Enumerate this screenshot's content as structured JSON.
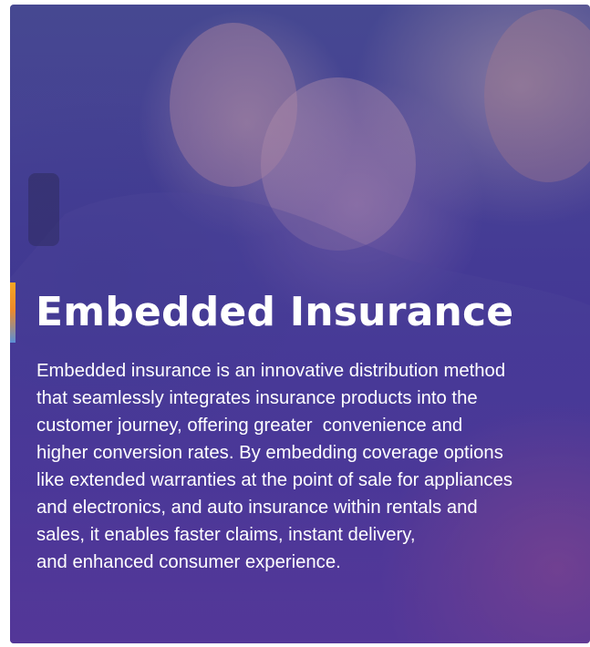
{
  "hero": {
    "title": "Embedded Insurance",
    "description_lines": [
      "Embedded insurance is an innovative distribution method",
      "that seamlessly integrates insurance products into the",
      "customer journey, offering greater  convenience and",
      "higher conversion rates. By embedding coverage options",
      "like extended warranties at the point of sale for appliances",
      "and electronics, and auto insurance within rentals and",
      "sales, it enables faster claims, instant delivery,",
      "and enhanced consumer experience."
    ],
    "colors": {
      "overlay_top": "#4b4e97",
      "overlay_bottom": "#6a3d98",
      "overlay_pink": "#d65a80",
      "accent_orange": "#f6a623",
      "accent_blue": "#5b8fd6",
      "text": "#ffffff"
    },
    "background_image": "family-with-baby-photo"
  }
}
